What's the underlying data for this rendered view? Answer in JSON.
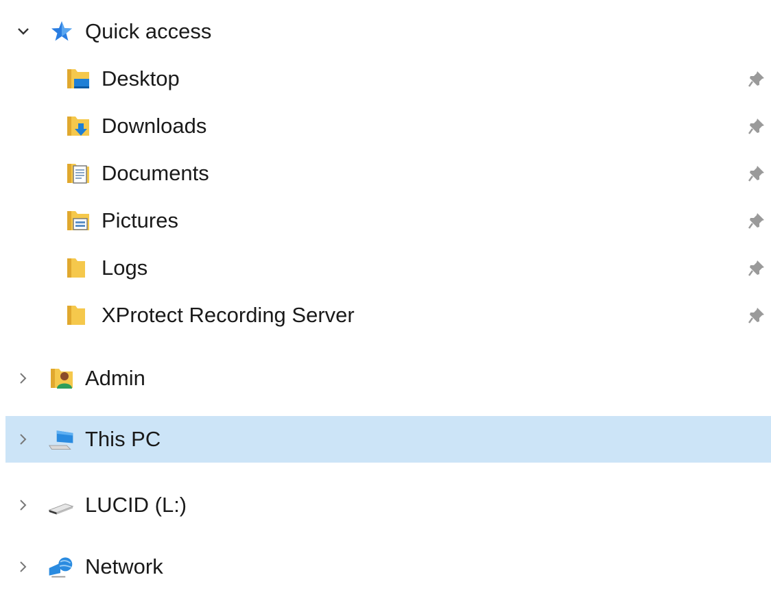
{
  "navigation_pane": {
    "quick_access": {
      "label": "Quick access",
      "icon": "star-icon",
      "expanded": true,
      "items": [
        {
          "label": "Desktop",
          "icon": "desktop-folder-icon",
          "pinned": true
        },
        {
          "label": "Downloads",
          "icon": "downloads-folder-icon",
          "pinned": true
        },
        {
          "label": "Documents",
          "icon": "documents-folder-icon",
          "pinned": true
        },
        {
          "label": "Pictures",
          "icon": "pictures-folder-icon",
          "pinned": true
        },
        {
          "label": "Logs",
          "icon": "folder-icon",
          "pinned": true
        },
        {
          "label": "XProtect Recording Server",
          "icon": "folder-icon",
          "pinned": true
        }
      ]
    },
    "roots": [
      {
        "label": "Admin",
        "icon": "user-folder-icon",
        "expanded": false,
        "selected": false
      },
      {
        "label": "This PC",
        "icon": "computer-icon",
        "expanded": false,
        "selected": true
      },
      {
        "label": "LUCID (L:)",
        "icon": "drive-icon",
        "expanded": false,
        "selected": false
      },
      {
        "label": "Network",
        "icon": "network-icon",
        "expanded": false,
        "selected": false
      }
    ]
  },
  "colors": {
    "selection_background": "#cce4f7",
    "folder_yellow": "#f5c84c",
    "accent_blue": "#1e88e5"
  }
}
